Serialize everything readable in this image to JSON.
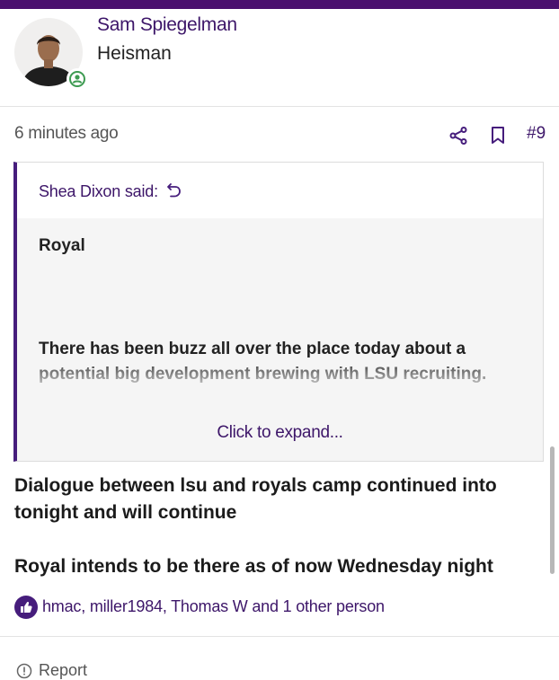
{
  "colors": {
    "brand": "#4a0f6e",
    "accent": "#461d7c",
    "link": "#3d1669",
    "online": "#3e9b52"
  },
  "post": {
    "author": {
      "name": "Sam Spiegelman",
      "title": "Heisman",
      "avatar_icon": "user-avatar",
      "status_icon": "online-status-icon"
    },
    "timestamp": "6 minutes ago",
    "actions": {
      "share_icon": "share-icon",
      "bookmark_icon": "bookmark-icon",
      "post_number": "#9"
    },
    "quote": {
      "author_label": "Shea Dixon said:",
      "jump_icon": "jump-to-quote-icon",
      "heading": "Royal",
      "text": "There has been buzz all over the place today about a potential big development brewing with LSU recruiting.",
      "expand_label": "Click to expand..."
    },
    "body": {
      "paragraph_1": "Dialogue between lsu and royals camp continued into tonight and will continue",
      "paragraph_2": "Royal intends to be there as of now Wednesday night"
    },
    "reactions": {
      "icon": "like-icon",
      "text": "hmac, miller1984, Thomas W and 1 other person"
    },
    "report": {
      "icon": "report-icon",
      "label": "Report"
    }
  }
}
